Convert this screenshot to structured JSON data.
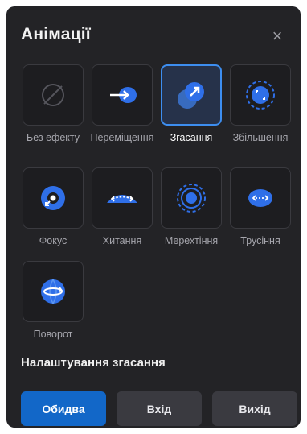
{
  "panel": {
    "title": "Анімації",
    "close_glyph": "×"
  },
  "effects": [
    {
      "label": "Без ефекту",
      "icon": "no-effect-icon",
      "selected": false
    },
    {
      "label": "Переміщення",
      "icon": "move-icon",
      "selected": false
    },
    {
      "label": "Згасання",
      "icon": "fade-icon",
      "selected": true
    },
    {
      "label": "Збільшення",
      "icon": "zoom-icon",
      "selected": false
    },
    {
      "label": "Фокус",
      "icon": "focus-icon",
      "selected": false
    },
    {
      "label": "Хитання",
      "icon": "wobble-icon",
      "selected": false
    },
    {
      "label": "Мерехтіння",
      "icon": "flicker-icon",
      "selected": false
    },
    {
      "label": "Трусіння",
      "icon": "shake-icon",
      "selected": false
    },
    {
      "label": "Поворот",
      "icon": "rotate-icon",
      "selected": false
    }
  ],
  "settings": {
    "title": "Налаштування згасання",
    "tabs": [
      {
        "label": "Обидва",
        "active": true
      },
      {
        "label": "Вхід",
        "active": false
      },
      {
        "label": "Вихід",
        "active": false
      }
    ]
  },
  "colors": {
    "accent": "#1267c8",
    "icon_blue": "#2f6fe8",
    "panel_bg": "#232326"
  }
}
